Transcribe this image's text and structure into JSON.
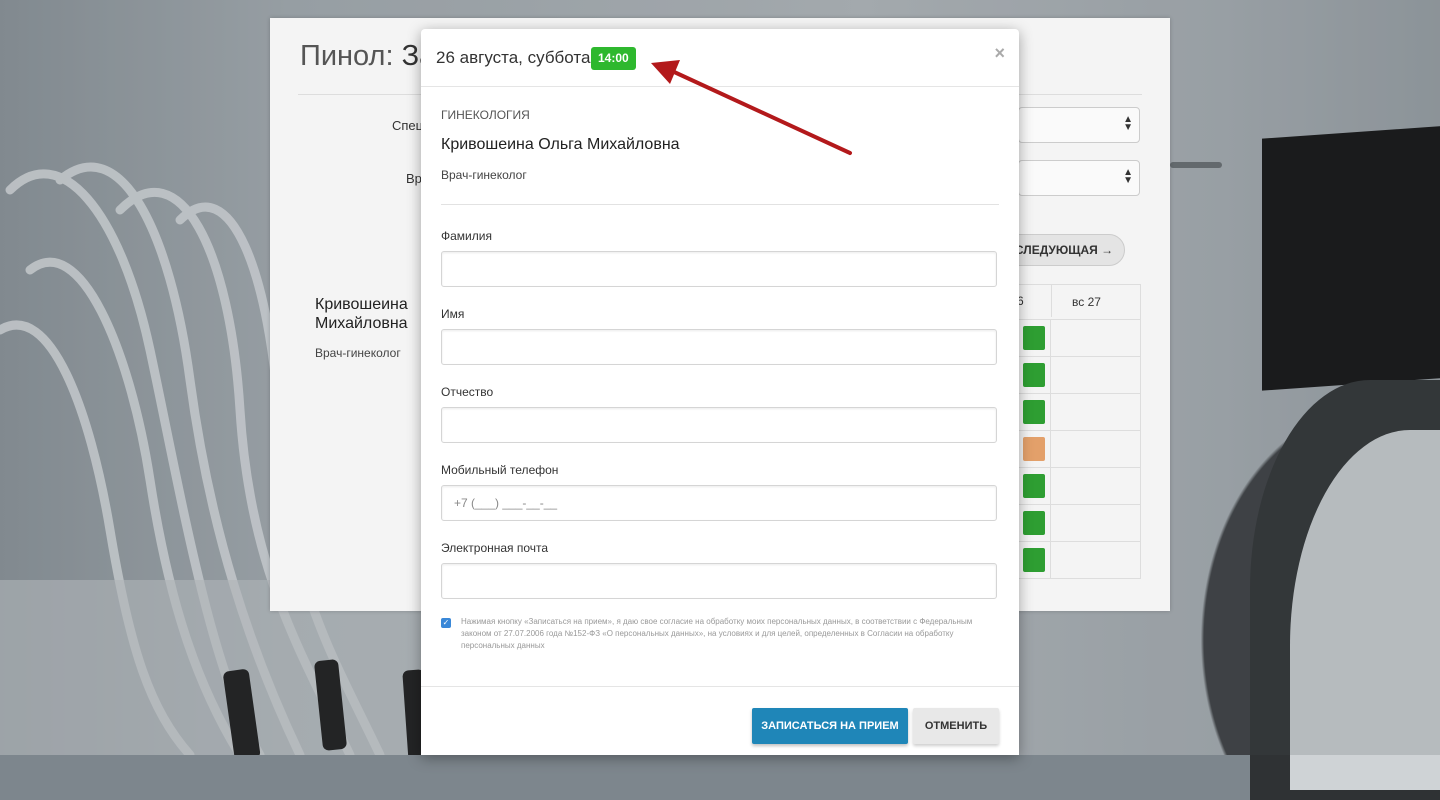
{
  "page": {
    "title_prefix": "Пинол:",
    "title_suffix": "За",
    "spec_label_partial": "Спец",
    "doctor_label_partial": "Вр",
    "next_button": "СЛЕДУЮЩАЯ →",
    "doctor_name_line1": "Кривошеина",
    "doctor_name_line2": "Михайловна",
    "doctor_role": "Врач-гинеколог",
    "day_prev_partial": "6",
    "day_header": "вс  27",
    "slot_colors": [
      "#2e9e32",
      "#2e9e32",
      "#2e9e32",
      "#e3a06a",
      "#2e9e32",
      "#2e9e32",
      "#2e9e32"
    ]
  },
  "modal": {
    "title": "26 августа, суббота",
    "time": "14:00",
    "close": "×",
    "section": "ГИНЕКОЛОГИЯ",
    "doctor": "Кривошеина Ольга Михайловна",
    "role": "Врач-гинеколог",
    "fields": {
      "last_name": "Фамилия",
      "first_name": "Имя",
      "middle_name": "Отчество",
      "phone": "Мобильный телефон",
      "phone_placeholder": "+7 (___) ___-__-__",
      "email": "Электронная почта"
    },
    "consent": "Нажимая кнопку «Записаться на прием», я даю свое согласие на обработку моих персональных данных, в соответствии с Федеральным законом от 27.07.2006 года №152-ФЗ «О персональных данных», на условиях и для целей, определенных в Согласии на обработку персональных данных",
    "submit": "ЗАПИСАТЬСЯ НА ПРИЕМ",
    "cancel": "ОТМЕНИТЬ"
  },
  "colors": {
    "badge": "#2eb82e",
    "primary": "#1f86b8",
    "arrow": "#b3191b"
  }
}
